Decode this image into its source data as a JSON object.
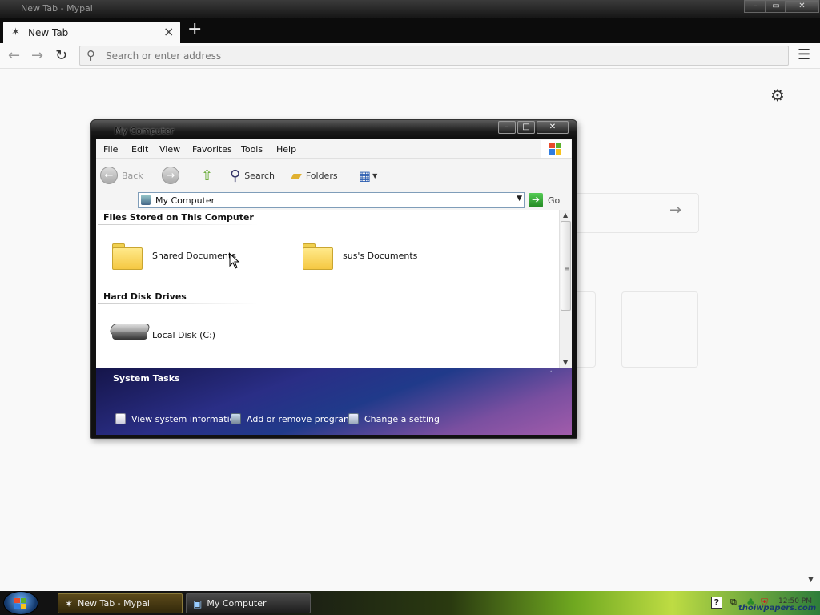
{
  "browser": {
    "title": "New Tab - Mypal",
    "tab_label": "New Tab",
    "url_placeholder": "Search or enter address"
  },
  "explorer": {
    "title": "My Computer",
    "menus": [
      "File",
      "Edit",
      "View",
      "Favorites",
      "Tools",
      "Help"
    ],
    "toolbar": {
      "back": "Back",
      "search": "Search",
      "folders": "Folders"
    },
    "address": {
      "value": "My Computer",
      "go": "Go"
    },
    "groups": {
      "files_header": "Files Stored on This Computer",
      "drives_header": "Hard Disk Drives"
    },
    "items": {
      "shared": "Shared Documents",
      "sus": "sus's Documents",
      "local_disk": "Local Disk (C:)"
    },
    "tasks": {
      "title": "System Tasks",
      "items": [
        "View system information",
        "Add or remove programs",
        "Change a setting"
      ]
    }
  },
  "taskbar": {
    "buttons": [
      "New Tab - Mypal",
      "My Computer"
    ],
    "clock": "12:50 PM",
    "watermark": "thoiwpapers.com"
  },
  "icons": {
    "back": "arrow-left-icon",
    "forward": "arrow-right-icon",
    "reload": "reload-icon",
    "search": "magnifier-icon",
    "menu": "hamburger-menu-icon",
    "settings": "gear-icon",
    "folder": "folder-icon",
    "disk": "hard-disk-icon"
  },
  "colors": {
    "tasks_panel": "#2a2e86",
    "folder": "#f5c842",
    "taskbar_accent": "#bedc43"
  }
}
